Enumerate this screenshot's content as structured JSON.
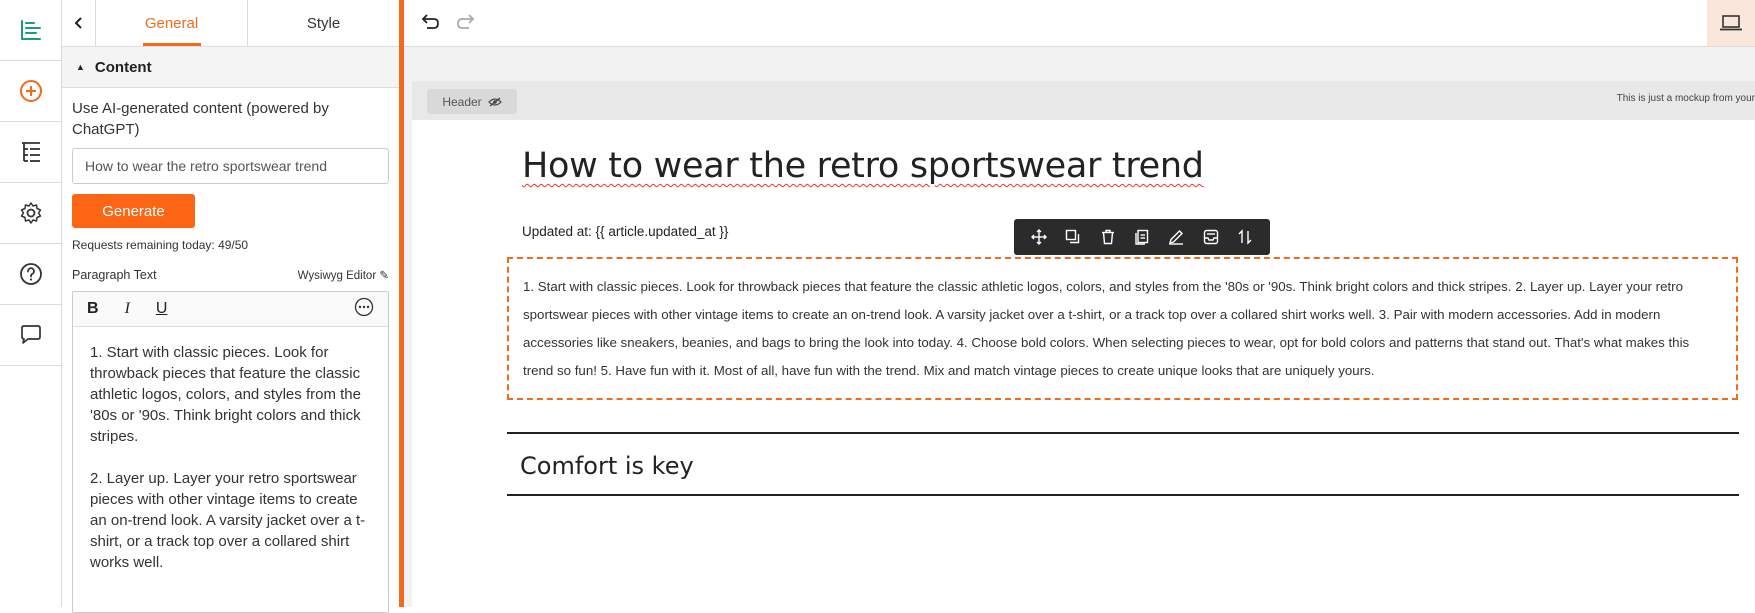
{
  "panel": {
    "tabs": [
      {
        "label": "General",
        "active": true
      },
      {
        "label": "Style",
        "active": false
      }
    ],
    "section_title": "Content",
    "ai_label": "Use AI-generated content (powered by ChatGPT)",
    "ai_input_value": "How to wear the retro sportswear trend",
    "generate_label": "Generate",
    "requests_text": "Requests remaining today: 49/50",
    "paragraph_label": "Paragraph Text",
    "editor_mode_label": "Wysiwyg Editor",
    "editor_paragraphs": [
      "1. Start with classic pieces. Look for throwback pieces that feature the classic athletic logos, colors, and styles from the '80s or '90s. Think bright colors and thick stripes.",
      "2. Layer up. Layer your retro sportswear pieces with other vintage items to create an on-trend look. A varsity jacket over a t-shirt, or a track top over a collared shirt works well."
    ]
  },
  "canvas": {
    "header_chip_label": "Header",
    "mockup_note": "This is just a mockup from your",
    "article_title": "How to wear the retro sportswear trend",
    "updated_text": "Updated at: {{ article.updated_at }}",
    "paragraph_text": "1. Start with classic pieces. Look for throwback pieces that feature the classic athletic logos, colors, and styles from the '80s or '90s. Think bright colors and thick stripes. 2. Layer up. Layer your retro sportswear pieces with other vintage items to create an on-trend look. A varsity jacket over a t-shirt, or a track top over a collared shirt works well. 3. Pair with modern accessories. Add in modern accessories like sneakers, beanies, and bags to bring the look into today. 4. Choose bold colors. When selecting pieces to wear, opt for bold colors and patterns that stand out. That's what makes this trend so fun! 5. Have fun with it. Most of all, have fun with the trend. Mix and match vintage pieces to create unique looks that are uniquely yours.",
    "subheading": "Comfort is key"
  },
  "icons": {
    "rail": [
      "layout-icon",
      "add-circle-icon",
      "structure-tree-icon",
      "gear-icon",
      "help-icon",
      "chat-icon"
    ],
    "block_toolbar": [
      "move-icon",
      "duplicate-icon",
      "trash-icon",
      "copy-icon",
      "edit-icon",
      "save-block-icon",
      "swap-icon"
    ]
  },
  "colors": {
    "accent": "#f26a1b",
    "generate_button": "#fb6514",
    "rail_icon": "#1e9b7a"
  }
}
